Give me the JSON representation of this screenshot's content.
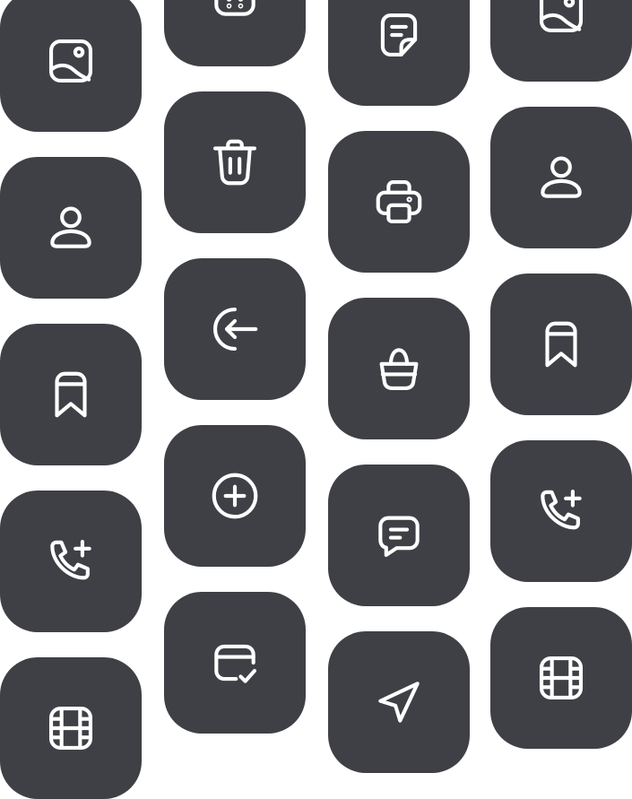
{
  "colors": {
    "background": "#ffffff",
    "tile": "#3f4046",
    "icon_stroke": "#ffffff"
  },
  "columns": [
    {
      "tiles": [
        {
          "icon": "image-icon"
        },
        {
          "icon": "user-icon"
        },
        {
          "icon": "bookmark-icon"
        },
        {
          "icon": "phone-add-icon"
        },
        {
          "icon": "film-icon"
        }
      ]
    },
    {
      "tiles": [
        {
          "icon": "calendar-icon"
        },
        {
          "icon": "trash-icon"
        },
        {
          "icon": "logout-icon"
        },
        {
          "icon": "add-circle-icon"
        },
        {
          "icon": "card-check-icon"
        }
      ]
    },
    {
      "tiles": [
        {
          "icon": "document-icon"
        },
        {
          "icon": "printer-icon"
        },
        {
          "icon": "shopping-bag-icon"
        },
        {
          "icon": "message-icon"
        },
        {
          "icon": "send-icon"
        }
      ]
    },
    {
      "tiles": [
        {
          "icon": "image-icon"
        },
        {
          "icon": "user-icon"
        },
        {
          "icon": "bookmark-icon"
        },
        {
          "icon": "phone-add-icon"
        },
        {
          "icon": "film-icon"
        }
      ]
    }
  ]
}
